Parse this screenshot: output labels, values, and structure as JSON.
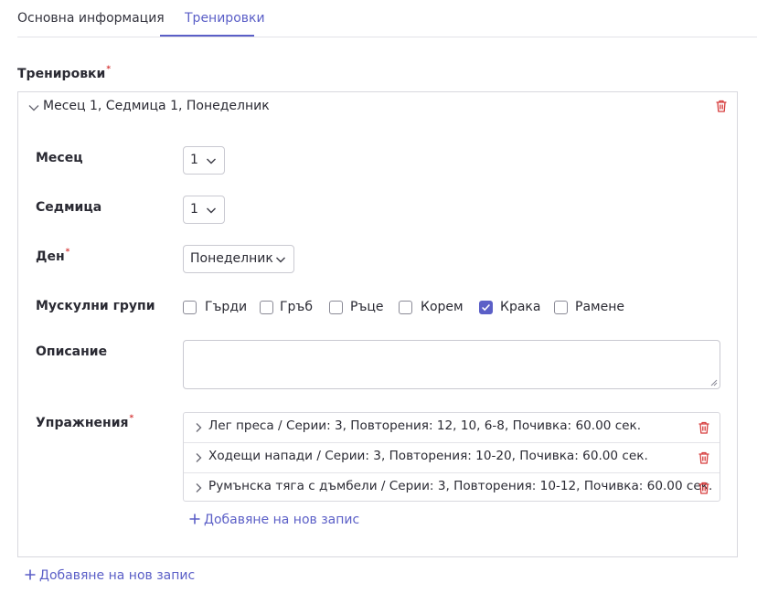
{
  "tabs": [
    "Основна информация",
    "Тренировки"
  ],
  "active_tab": "Тренировки",
  "section": {
    "label": "Тренировки",
    "required": "*"
  },
  "card": {
    "title": "Месец 1, Седмица 1, Понеделник",
    "fields": {
      "month": {
        "label": "Месец",
        "value": "1"
      },
      "week": {
        "label": "Седмица",
        "value": "1"
      },
      "day": {
        "label": "Ден",
        "required": "*",
        "value": "Понеделник"
      },
      "muscle_groups": {
        "label": "Мускулни групи",
        "options": [
          {
            "label": "Гърди",
            "checked": false
          },
          {
            "label": "Гръб",
            "checked": false
          },
          {
            "label": "Ръце",
            "checked": false
          },
          {
            "label": "Корем",
            "checked": false
          },
          {
            "label": "Крака",
            "checked": true
          },
          {
            "label": "Рамене",
            "checked": false
          }
        ]
      },
      "description": {
        "label": "Описание",
        "value": ""
      },
      "exercises": {
        "label": "Упражнения",
        "required": "*",
        "items": [
          "Лег преса / Серии: 3, Повторения: 12, 10, 6-8, Почивка: 60.00 сек.",
          "Ходещи напади / Серии: 3, Повторения: 10-20, Почивка: 60.00 сек.",
          "Румънска тяга с дъмбели / Серии: 3, Повторения: 10-12, Почивка: 60.00 сек."
        ],
        "add_label": "Добавяне на нов запис"
      }
    }
  },
  "add_label": "Добавяне на нов запис",
  "colors": {
    "accent": "#5b5fc7",
    "danger": "#d63c3c",
    "border": "#d8d8de"
  }
}
